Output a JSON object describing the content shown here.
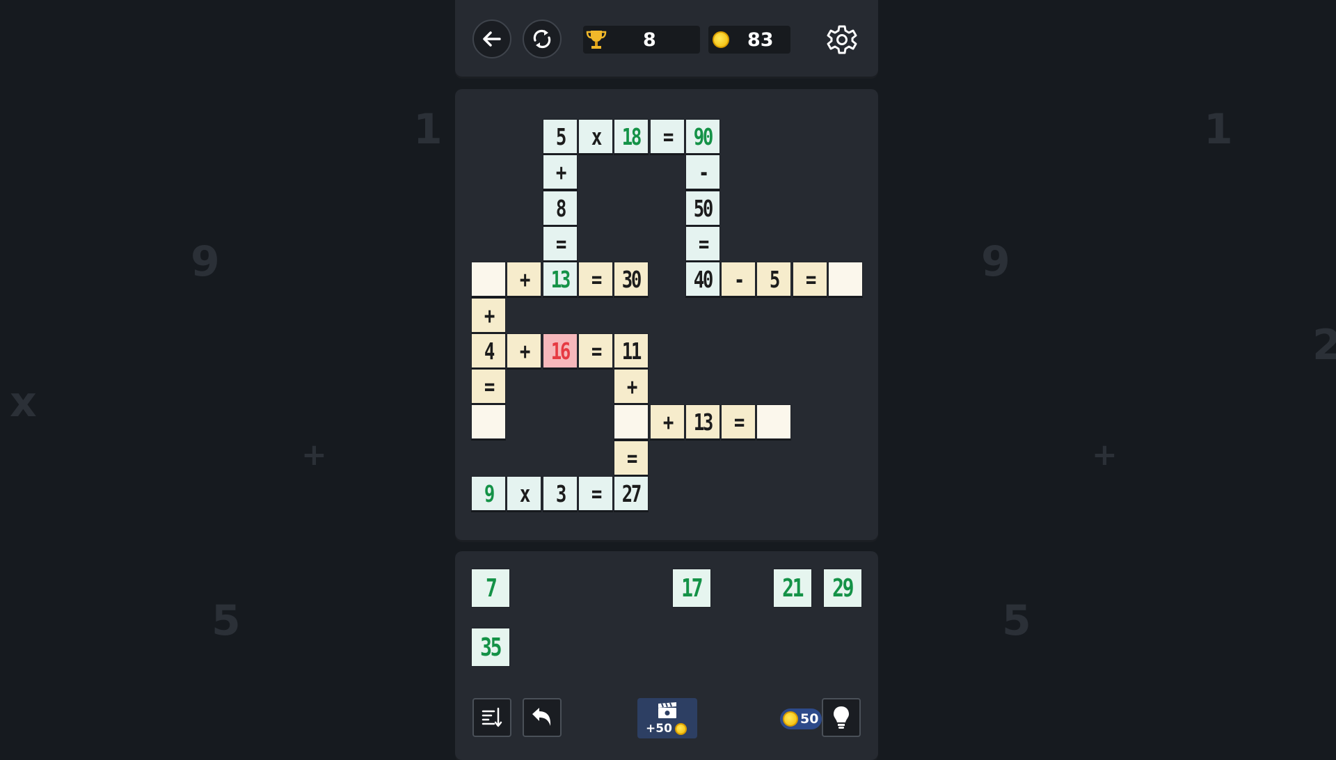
{
  "background": {
    "glyphs": [
      "1",
      "9",
      "x",
      "+",
      "5",
      "1",
      "9",
      "2",
      "+",
      "5"
    ]
  },
  "header": {
    "back_icon": "arrow-left-icon",
    "restart_icon": "refresh-icon",
    "trophy_icon": "trophy-icon",
    "trophy_value": "8",
    "coin_icon": "coin-icon",
    "coin_value": "83",
    "settings_icon": "gear-icon"
  },
  "board": {
    "cells": [
      {
        "row": 0,
        "col": 2,
        "text": "5",
        "color": "blue",
        "text_color": "black"
      },
      {
        "row": 0,
        "col": 3,
        "text": "x",
        "color": "blue",
        "text_color": "black"
      },
      {
        "row": 0,
        "col": 4,
        "text": "18",
        "color": "blue",
        "text_color": "green"
      },
      {
        "row": 0,
        "col": 5,
        "text": "=",
        "color": "blue",
        "text_color": "black"
      },
      {
        "row": 0,
        "col": 6,
        "text": "90",
        "color": "blue",
        "text_color": "green"
      },
      {
        "row": 1,
        "col": 2,
        "text": "+",
        "color": "blue",
        "text_color": "black"
      },
      {
        "row": 1,
        "col": 6,
        "text": "-",
        "color": "blue",
        "text_color": "black"
      },
      {
        "row": 2,
        "col": 2,
        "text": "8",
        "color": "blue",
        "text_color": "black"
      },
      {
        "row": 2,
        "col": 6,
        "text": "50",
        "color": "blue",
        "text_color": "black"
      },
      {
        "row": 3,
        "col": 2,
        "text": "=",
        "color": "blue",
        "text_color": "black"
      },
      {
        "row": 3,
        "col": 6,
        "text": "=",
        "color": "blue",
        "text_color": "black"
      },
      {
        "row": 4,
        "col": 0,
        "text": "",
        "color": "empty",
        "text_color": "black"
      },
      {
        "row": 4,
        "col": 1,
        "text": "+",
        "color": "yellow",
        "text_color": "black"
      },
      {
        "row": 4,
        "col": 2,
        "text": "13",
        "color": "blue",
        "text_color": "green"
      },
      {
        "row": 4,
        "col": 3,
        "text": "=",
        "color": "yellow",
        "text_color": "black"
      },
      {
        "row": 4,
        "col": 4,
        "text": "30",
        "color": "yellow",
        "text_color": "black"
      },
      {
        "row": 4,
        "col": 6,
        "text": "40",
        "color": "blue",
        "text_color": "black"
      },
      {
        "row": 4,
        "col": 7,
        "text": "-",
        "color": "yellow",
        "text_color": "black"
      },
      {
        "row": 4,
        "col": 8,
        "text": "5",
        "color": "yellow",
        "text_color": "black"
      },
      {
        "row": 4,
        "col": 9,
        "text": "=",
        "color": "yellow",
        "text_color": "black"
      },
      {
        "row": 4,
        "col": 10,
        "text": "",
        "color": "empty",
        "text_color": "black"
      },
      {
        "row": 5,
        "col": 0,
        "text": "+",
        "color": "yellow",
        "text_color": "black"
      },
      {
        "row": 6,
        "col": 0,
        "text": "4",
        "color": "yellow",
        "text_color": "black"
      },
      {
        "row": 6,
        "col": 1,
        "text": "+",
        "color": "yellow",
        "text_color": "black"
      },
      {
        "row": 6,
        "col": 2,
        "text": "16",
        "color": "red",
        "text_color": "red"
      },
      {
        "row": 6,
        "col": 3,
        "text": "=",
        "color": "yellow",
        "text_color": "black"
      },
      {
        "row": 6,
        "col": 4,
        "text": "11",
        "color": "yellow",
        "text_color": "black"
      },
      {
        "row": 7,
        "col": 0,
        "text": "=",
        "color": "yellow",
        "text_color": "black"
      },
      {
        "row": 7,
        "col": 4,
        "text": "+",
        "color": "yellow",
        "text_color": "black"
      },
      {
        "row": 8,
        "col": 0,
        "text": "",
        "color": "empty",
        "text_color": "black"
      },
      {
        "row": 8,
        "col": 4,
        "text": "",
        "color": "empty",
        "text_color": "black"
      },
      {
        "row": 8,
        "col": 5,
        "text": "+",
        "color": "yellow",
        "text_color": "black"
      },
      {
        "row": 8,
        "col": 6,
        "text": "13",
        "color": "yellow",
        "text_color": "black"
      },
      {
        "row": 8,
        "col": 7,
        "text": "=",
        "color": "yellow",
        "text_color": "black"
      },
      {
        "row": 8,
        "col": 8,
        "text": "",
        "color": "empty",
        "text_color": "black"
      },
      {
        "row": 9,
        "col": 4,
        "text": "=",
        "color": "yellow",
        "text_color": "black"
      },
      {
        "row": 10,
        "col": 0,
        "text": "9",
        "color": "blue",
        "text_color": "green"
      },
      {
        "row": 10,
        "col": 1,
        "text": "x",
        "color": "blue",
        "text_color": "black"
      },
      {
        "row": 10,
        "col": 2,
        "text": "3",
        "color": "blue",
        "text_color": "black"
      },
      {
        "row": 10,
        "col": 3,
        "text": "=",
        "color": "blue",
        "text_color": "black"
      },
      {
        "row": 10,
        "col": 4,
        "text": "27",
        "color": "blue",
        "text_color": "black"
      }
    ]
  },
  "tray": {
    "tiles": [
      {
        "slot": 0,
        "row": 0,
        "text": "7"
      },
      {
        "slot": 4,
        "row": 0,
        "text": "17"
      },
      {
        "slot": 6,
        "row": 0,
        "text": "21"
      },
      {
        "slot": 7,
        "row": 0,
        "text": "29"
      },
      {
        "slot": 0,
        "row": 1,
        "text": "35"
      }
    ]
  },
  "footer": {
    "sort_icon": "sort-icon",
    "undo_icon": "undo-icon",
    "video_icon": "clapperboard-icon",
    "video_reward": "+50",
    "hint_cost": "50",
    "hint_icon": "lightbulb-icon"
  },
  "colors": {
    "blue_cell": "#e5f3f0",
    "yellow_cell": "#f6eccc",
    "empty_cell": "#fbf7ec",
    "red_cell": "#f6b8bb",
    "green_text": "#149247",
    "red_text": "#e63a43"
  }
}
